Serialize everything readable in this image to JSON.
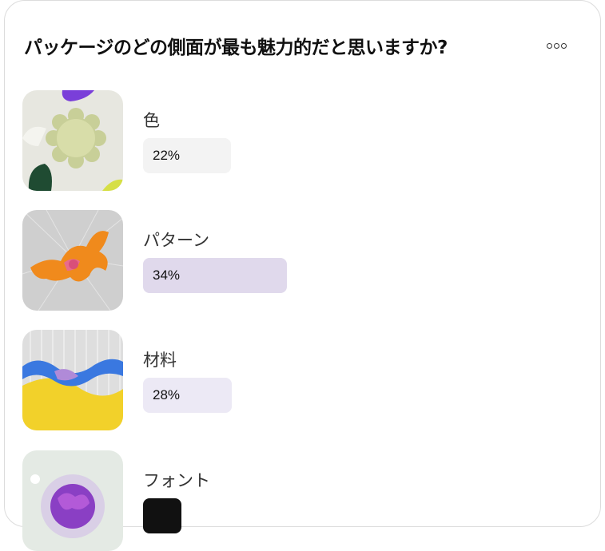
{
  "poll": {
    "question": "パッケージのどの側面が最も魅力的だと思いますか?",
    "options": [
      {
        "label": "色",
        "percent_label": "22%",
        "percent": 22,
        "bar_color": "#f3f3f3"
      },
      {
        "label": "パターン",
        "percent_label": "34%",
        "percent": 34,
        "bar_color": "#e0d9ec"
      },
      {
        "label": "材料",
        "percent_label": "28%",
        "percent": 28,
        "bar_color": "#ece9f5"
      },
      {
        "label": "フォント",
        "percent_label": "",
        "percent": 0,
        "bar_color": "#111111"
      }
    ]
  },
  "icons": {
    "more": "more-options-icon"
  }
}
